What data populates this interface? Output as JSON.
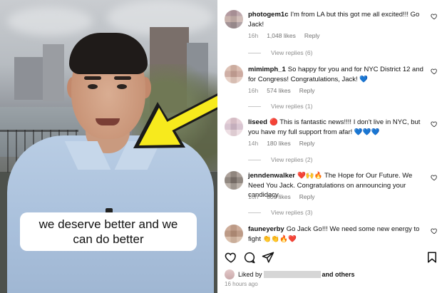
{
  "video": {
    "caption_line1": "we deserve better and we",
    "caption_line2": "can do better",
    "arrow_color": "#f7ea1d"
  },
  "comments": [
    {
      "username": "photogem1c",
      "text": "I'm from LA but this got me all excited!!! Go Jack!",
      "time": "16h",
      "likes": "1,048 likes",
      "reply_label": "Reply",
      "view_replies": "View replies (6)"
    },
    {
      "username": "mimimph_1",
      "text": "So happy for you and for NYC District 12 and for Congress! Congratulations, Jack! 💙",
      "time": "16h",
      "likes": "574 likes",
      "reply_label": "Reply",
      "view_replies": "View replies (1)"
    },
    {
      "username": "liseed",
      "text": "🔴 This is fantastic news!!!! I don't live in NYC, but you have my full support from afar! 💙💙💙",
      "time": "14h",
      "likes": "180 likes",
      "reply_label": "Reply",
      "view_replies": "View replies (2)"
    },
    {
      "username": "jenndenwalker",
      "text": "❤️🙌🔥 The Hope for Our Future. We Need You Jack. Congratulations on announcing your candidacy.",
      "time": "16h",
      "likes": "808 likes",
      "reply_label": "Reply",
      "view_replies": "View replies (3)"
    },
    {
      "username": "fauneyerby",
      "text": "Go Jack Go!!! We need some new energy to fight 👏👏🔥❤️",
      "time": "",
      "likes": "",
      "reply_label": "",
      "view_replies": ""
    }
  ],
  "footer": {
    "liked_by_prefix": "Liked by",
    "and_others": "and others",
    "timestamp": "16 hours ago"
  },
  "icons": {
    "like": "heart-icon",
    "comment": "comment-icon",
    "share": "paper-plane-icon",
    "save": "bookmark-icon"
  }
}
